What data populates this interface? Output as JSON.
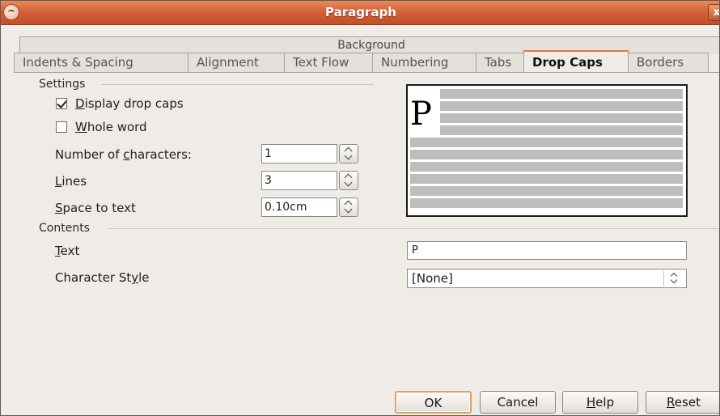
{
  "window": {
    "title": "Paragraph",
    "close_label": "x"
  },
  "tabs": {
    "back_row": "Background",
    "front_row": [
      {
        "label": "Indents & Spacing",
        "active": false
      },
      {
        "label": "Alignment",
        "active": false
      },
      {
        "label": "Text Flow",
        "active": false
      },
      {
        "label": "Numbering",
        "active": false
      },
      {
        "label": "Tabs",
        "active": false
      },
      {
        "label": "Drop Caps",
        "active": true
      },
      {
        "label": "Borders",
        "active": false
      }
    ]
  },
  "settings": {
    "heading": "Settings",
    "display_drop_caps": {
      "mnemonic": "D",
      "rest": "isplay drop caps",
      "checked": true
    },
    "whole_word": {
      "mnemonic": "W",
      "rest": "hole word",
      "checked": false
    },
    "num_chars": {
      "pre": "Number of ",
      "mnemonic": "c",
      "post": "haracters:",
      "value": "1"
    },
    "lines": {
      "pre": "",
      "mnemonic": "L",
      "post": "ines",
      "value": "3"
    },
    "space_to_text": {
      "pre": "",
      "mnemonic": "S",
      "post": "pace to text",
      "value": "0.10cm"
    }
  },
  "preview": {
    "drop_char": "P"
  },
  "contents": {
    "heading": "Contents",
    "text": {
      "pre": "",
      "mnemonic": "T",
      "post": "ext",
      "value": "P"
    },
    "char_style": {
      "pre": "Character St",
      "mnemonic": "y",
      "post": "le",
      "value": "[None]"
    }
  },
  "buttons": {
    "ok": "OK",
    "cancel": "Cancel",
    "help": {
      "mnemonic": "H",
      "rest": "elp"
    },
    "reset": {
      "mnemonic": "R",
      "rest": "eset"
    }
  },
  "colors": {
    "titlebar": "#d4623a",
    "active_tab_accent": "#e07b36",
    "window_bg": "#efebe7"
  }
}
